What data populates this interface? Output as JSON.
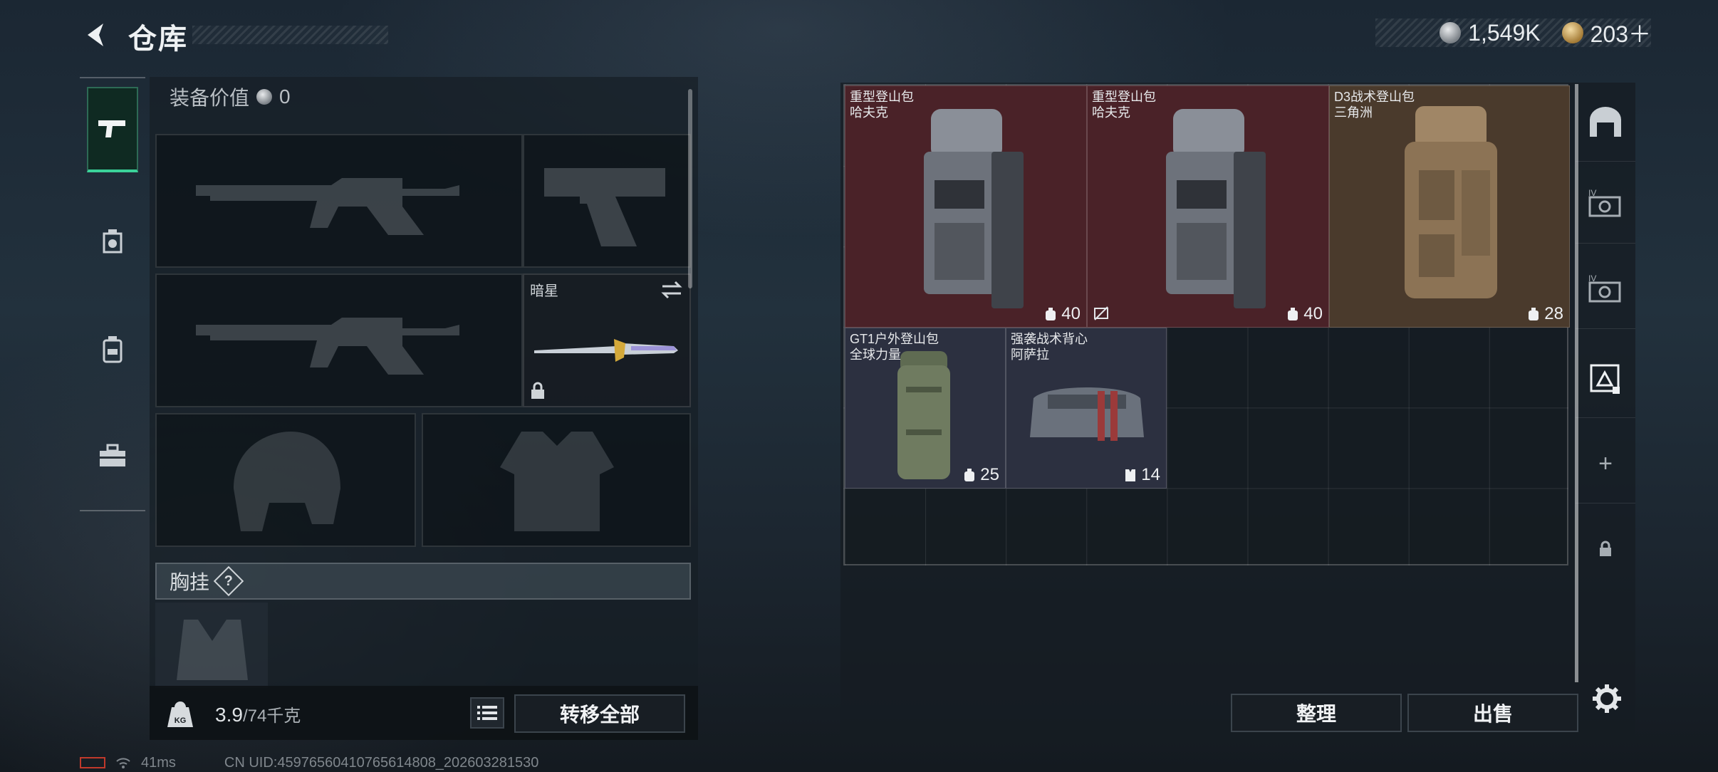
{
  "header": {
    "title": "仓库"
  },
  "currency": {
    "silver": "1,549K",
    "gold": "203＋"
  },
  "equipment": {
    "value_label": "装备价值",
    "value": "0",
    "melee": {
      "name": "暗星"
    },
    "chest_rig_label": "胸挂",
    "chest_rig_help": "?"
  },
  "weight": {
    "current": "3.9",
    "max": "/74千克",
    "icon_label": "KG"
  },
  "buttons": {
    "transfer_all": "转移全部",
    "sort": "整理",
    "sell": "出售"
  },
  "items": [
    {
      "line1": "重型登山包",
      "line2": "哈夫克",
      "capacity": "40"
    },
    {
      "line1": "重型登山包",
      "line2": "哈夫克",
      "capacity": "40"
    },
    {
      "line1": "D3战术登山包",
      "line2": "三角洲",
      "capacity": "28"
    },
    {
      "line1": "GT1户外登山包",
      "line2": "全球力量",
      "capacity": "25"
    },
    {
      "line1": "强袭战术背心",
      "line2": "阿萨拉",
      "capacity": "14"
    }
  ],
  "right_rail": {
    "tier_a": "IV",
    "tier_b": "IV",
    "add": "+"
  },
  "status": {
    "ping": "41ms",
    "uid": "CN UID:4597656041076561480‌8_202603281530"
  },
  "colors": {
    "accent_green": "#3bd29a",
    "item_red": "#4a2228",
    "item_brown": "#4a3a2c",
    "item_slate": "#2c3040"
  }
}
